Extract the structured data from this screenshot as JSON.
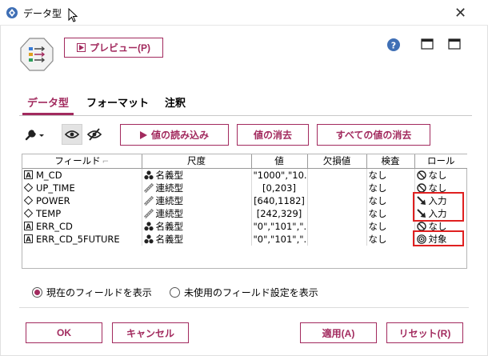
{
  "window": {
    "title": "データ型"
  },
  "toolbar": {
    "preview_label": "プレビュー(P)"
  },
  "tabs": [
    "データ型",
    "フォーマット",
    "注釈"
  ],
  "actions": {
    "read_values": "値の読み込み",
    "clear_values": "値の消去",
    "clear_all_values": "すべての値の消去"
  },
  "grid": {
    "columns": [
      "フィールド",
      "尺度",
      "値",
      "欠損値",
      "検査",
      "ロール"
    ],
    "rows": [
      {
        "field": "M_CD",
        "field_type": "string",
        "measure": "名義型",
        "measure_icon": "nominal-icon",
        "values": "\"1000\",\"10...",
        "missing": "",
        "check": "なし",
        "role": "なし",
        "role_icon": "none-role-icon"
      },
      {
        "field": "UP_TIME",
        "field_type": "numeric",
        "measure": "連続型",
        "measure_icon": "continuous-icon",
        "values": "[0,203]",
        "missing": "",
        "check": "なし",
        "role": "なし",
        "role_icon": "none-role-icon"
      },
      {
        "field": "POWER",
        "field_type": "numeric",
        "measure": "連続型",
        "measure_icon": "continuous-icon",
        "values": "[640,1182]",
        "missing": "",
        "check": "なし",
        "role": "入力",
        "role_icon": "input-role-icon"
      },
      {
        "field": "TEMP",
        "field_type": "numeric",
        "measure": "連続型",
        "measure_icon": "continuous-icon",
        "values": "[242,329]",
        "missing": "",
        "check": "なし",
        "role": "入力",
        "role_icon": "input-role-icon"
      },
      {
        "field": "ERR_CD",
        "field_type": "string",
        "measure": "名義型",
        "measure_icon": "nominal-icon",
        "values": "\"0\",\"101\",\"...",
        "missing": "",
        "check": "なし",
        "role": "なし",
        "role_icon": "none-role-icon"
      },
      {
        "field": "ERR_CD_5FUTURE",
        "field_type": "string",
        "measure": "名義型",
        "measure_icon": "nominal-icon",
        "values": "\"0\",\"101\",\"...",
        "missing": "",
        "check": "なし",
        "role": "対象",
        "role_icon": "target-role-icon"
      }
    ]
  },
  "options": {
    "show_current": "現在のフィールドを表示",
    "show_unused": "未使用のフィールド設定を表示",
    "selected": "show_current"
  },
  "footer": {
    "ok": "OK",
    "cancel": "キャンセル",
    "apply": "適用(A)",
    "reset": "リセット(R)"
  },
  "colors": {
    "accent": "#a22a5e",
    "highlight": "#e02020"
  }
}
